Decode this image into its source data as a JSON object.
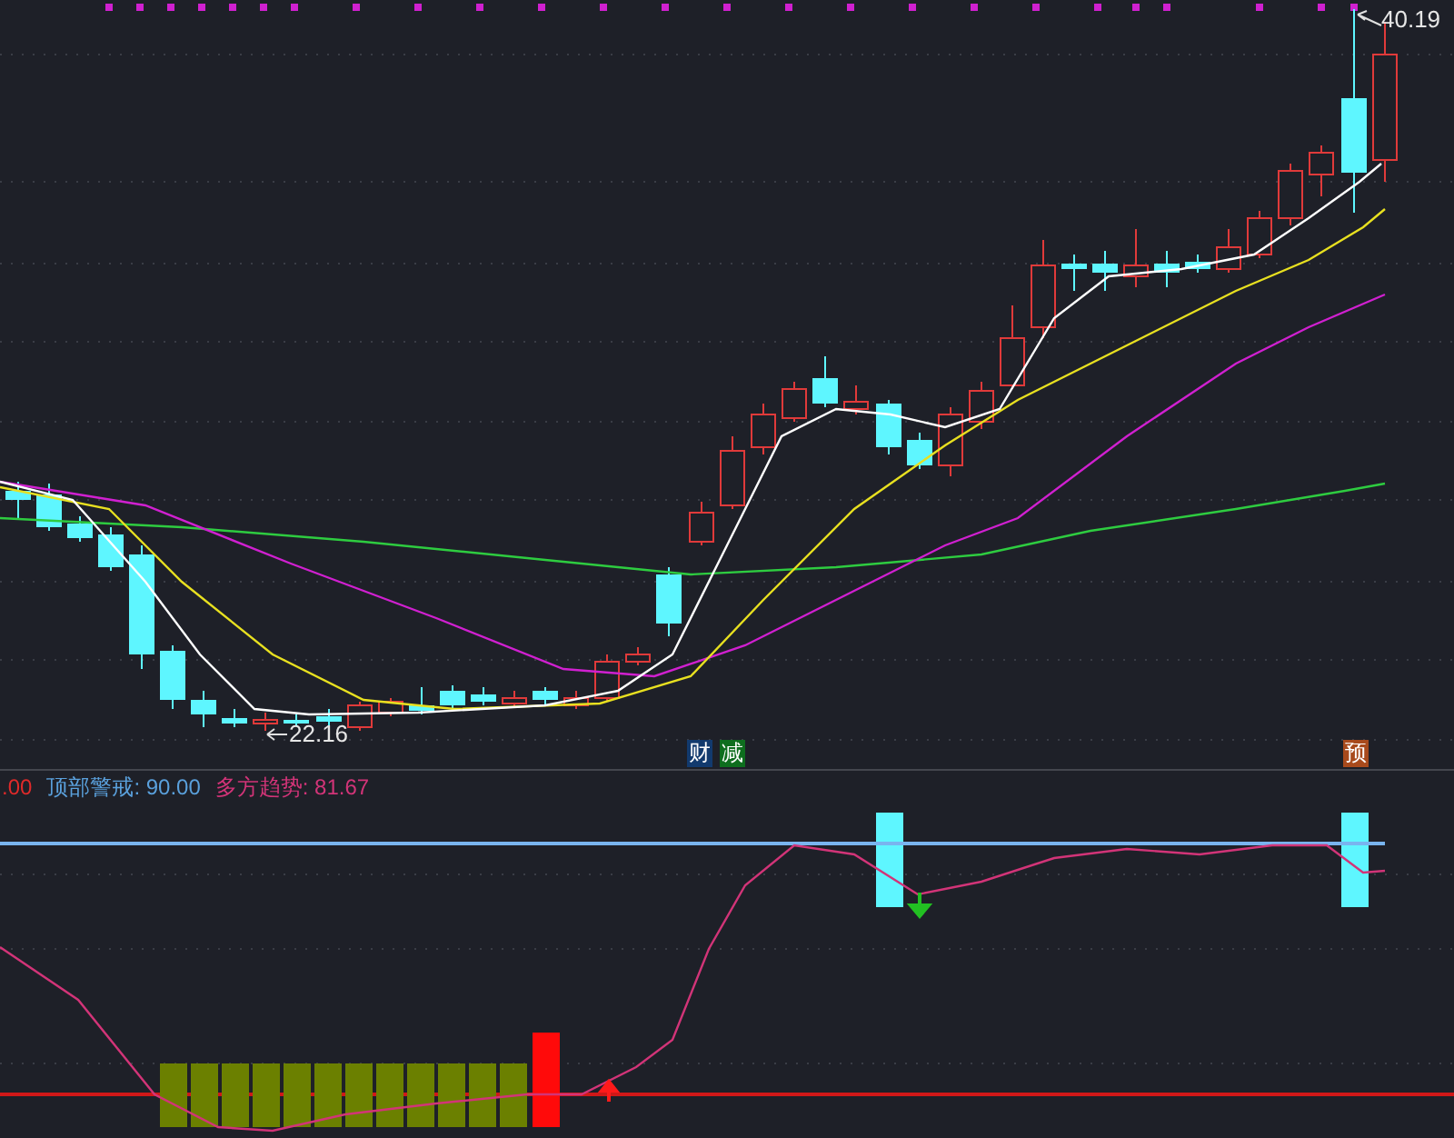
{
  "price_chart": {
    "high_label": "40.19",
    "low_label": "22.16",
    "event_tags": [
      {
        "text": "财",
        "color": "#123a6e"
      },
      {
        "text": "减",
        "color": "#0e6e1e"
      },
      {
        "text": "预",
        "color": "#a84a1c"
      }
    ]
  },
  "indicator": {
    "legend": [
      {
        "kind": "value",
        "text": ".00",
        "color": "#e02a2a"
      },
      {
        "kind": "series",
        "label": "顶部警戒:",
        "value": "90.00",
        "color": "#5aa0dc"
      },
      {
        "kind": "series",
        "label": "多方趋势:",
        "value": "81.67",
        "color": "#d23478"
      }
    ]
  }
}
